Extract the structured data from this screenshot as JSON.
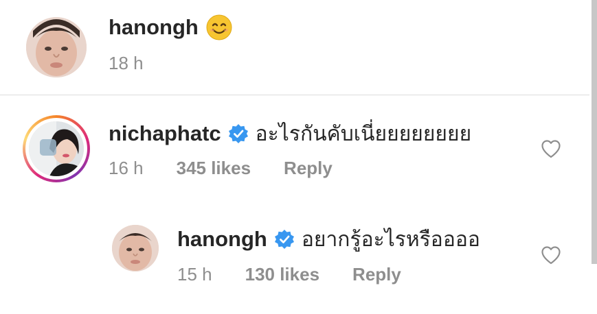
{
  "comments": [
    {
      "username": "hanongh",
      "text": "",
      "emoji": "smiling-face-emoji",
      "time": "18 h",
      "likes": "",
      "reply_label": ""
    },
    {
      "username": "nichaphatc",
      "verified": true,
      "text": "อะไรกันคับเนี่ยยยยยยยย",
      "time": "16 h",
      "likes": "345 likes",
      "reply_label": "Reply"
    },
    {
      "username": "hanongh",
      "verified": true,
      "text": "อยากรู้อะไรหรืออออ",
      "time": "15 h",
      "likes": "130 likes",
      "reply_label": "Reply"
    }
  ],
  "colors": {
    "text": "#262626",
    "secondary": "#8e8e8e",
    "verified": "#3897f0",
    "divider": "#dbdbdb"
  },
  "icons": [
    "verified-badge-icon",
    "heart-icon",
    "smiling-face-emoji"
  ]
}
